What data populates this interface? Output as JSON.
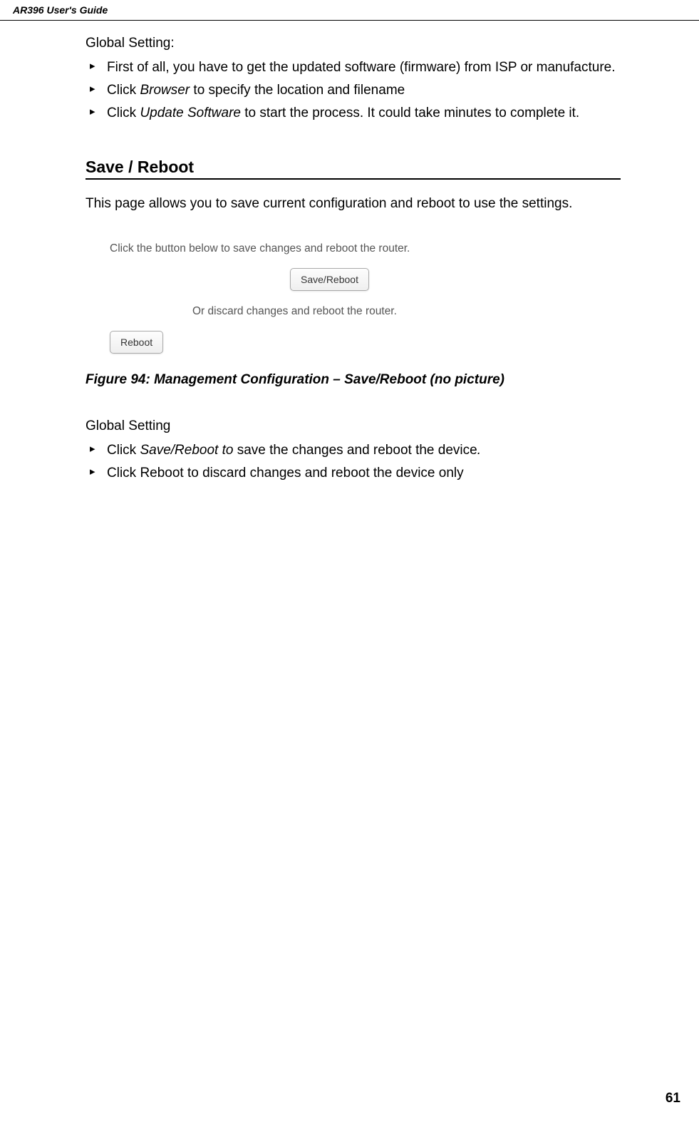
{
  "header": {
    "title": "AR396 User's Guide"
  },
  "section1": {
    "heading": "Global Setting:",
    "bullets": [
      {
        "pre": "First of all, you have to get the updated software (firmware) from ISP or manufacture."
      },
      {
        "pre": "Click ",
        "italic": "Browser",
        "post": " to specify the location and filename"
      },
      {
        "pre": "Click ",
        "italic": "Update Software",
        "post": " to start the process. It could take minutes to complete it."
      }
    ]
  },
  "section2": {
    "title": "Save / Reboot",
    "description": "This page allows you to save current configuration and reboot to use the settings.",
    "screenshot": {
      "line1": "Click the button below to save changes and reboot the router.",
      "button1": "Save/Reboot",
      "line2": "Or discard changes and reboot the router.",
      "button2": "Reboot"
    },
    "caption": "Figure 94: Management Configuration – Save/Reboot (no picture)"
  },
  "section3": {
    "heading": "Global Setting",
    "bullets": [
      {
        "pre": "Click ",
        "italic": "Save/Reboot to ",
        "post": "save the changes and reboot the device",
        "tail": "."
      },
      {
        "pre": "Click Reboot to discard changes and reboot the device only"
      }
    ]
  },
  "page_number": "61"
}
